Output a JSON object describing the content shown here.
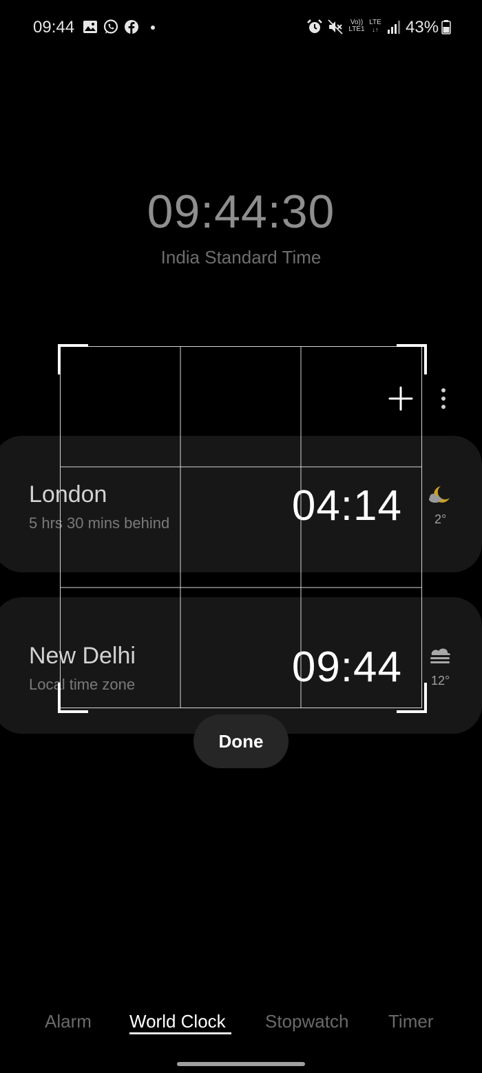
{
  "status_bar": {
    "time": "09:44",
    "battery": "43%",
    "volte_label": "Vo))",
    "lte_top": "LTE",
    "lte1_label": "LTE1",
    "notification_icons": [
      "gallery-icon",
      "whatsapp-icon",
      "facebook-icon",
      "dot-icon"
    ],
    "system_icons": [
      "alarm-icon",
      "mute-icon",
      "signal-icon",
      "battery-icon"
    ]
  },
  "main_clock": {
    "time": "09:44:30",
    "zone": "India Standard Time"
  },
  "toolbar": {
    "add_icon": "plus-icon",
    "more_icon": "more-vertical-icon"
  },
  "cities": [
    {
      "name": "London",
      "offset": "5 hrs 30 mins behind",
      "time": "04:14",
      "weather_icon": "moon-cloud-icon",
      "temp": "2°"
    },
    {
      "name": "New Delhi",
      "offset": "Local time zone",
      "time": "09:44",
      "weather_icon": "fog-cloud-icon",
      "temp": "12°"
    }
  ],
  "overlay": {
    "done_label": "Done"
  },
  "tabs": [
    {
      "label": "Alarm",
      "active": false
    },
    {
      "label": "World Clock",
      "active": true
    },
    {
      "label": "Stopwatch",
      "active": false
    },
    {
      "label": "Timer",
      "active": false
    }
  ],
  "colors": {
    "background": "#000000",
    "card": "#171717",
    "moon": "#c9a227",
    "done_button": "#262626"
  }
}
